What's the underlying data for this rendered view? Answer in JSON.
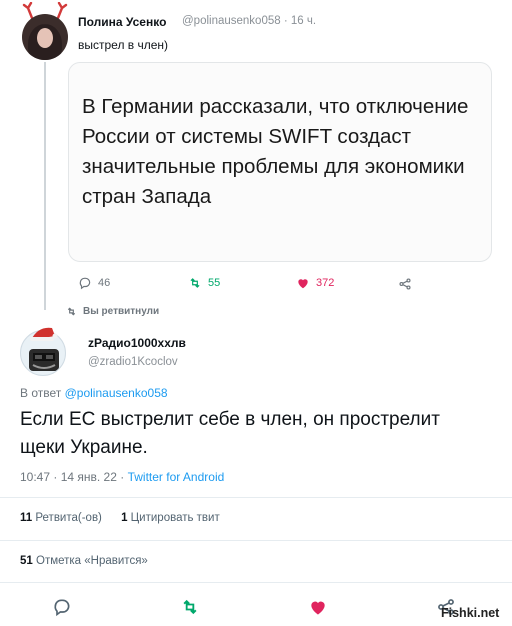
{
  "tweet1": {
    "author_name": "Полина Усенко",
    "handle_time": "@polinausenko058 · 16 ч.",
    "text": "выстрел в член)",
    "card_text": "В Германии рассказали, что отключение России от системы SWIFT создаст значительные проблемы для экономики стран Запада",
    "replies": "46",
    "retweets": "55",
    "likes": "372"
  },
  "retweet_note": "Вы ретвитнули",
  "tweet2": {
    "author_name": "zРадио1000xxлв",
    "handle": "@zradio1Kcoclov",
    "reply_prefix": "В ответ",
    "reply_handle": "@polinausenko058",
    "text": "Если ЕС выстрелит себе в член, он прострелит щеки Украине.",
    "time_date": "10:47 · 14 янв. 22 ·",
    "source": "Twitter for Android",
    "retweets_count": "11",
    "retweets_label": "Ретвита(-ов)",
    "quotes_count": "1",
    "quotes_label": "Цитировать твит",
    "likes_count": "51",
    "likes_label": "Отметка «Нравится»"
  },
  "watermark": "Fishki.net",
  "colors": {
    "retweet": "#00a86b",
    "like": "#e0245e",
    "link": "#1d9bf0"
  }
}
